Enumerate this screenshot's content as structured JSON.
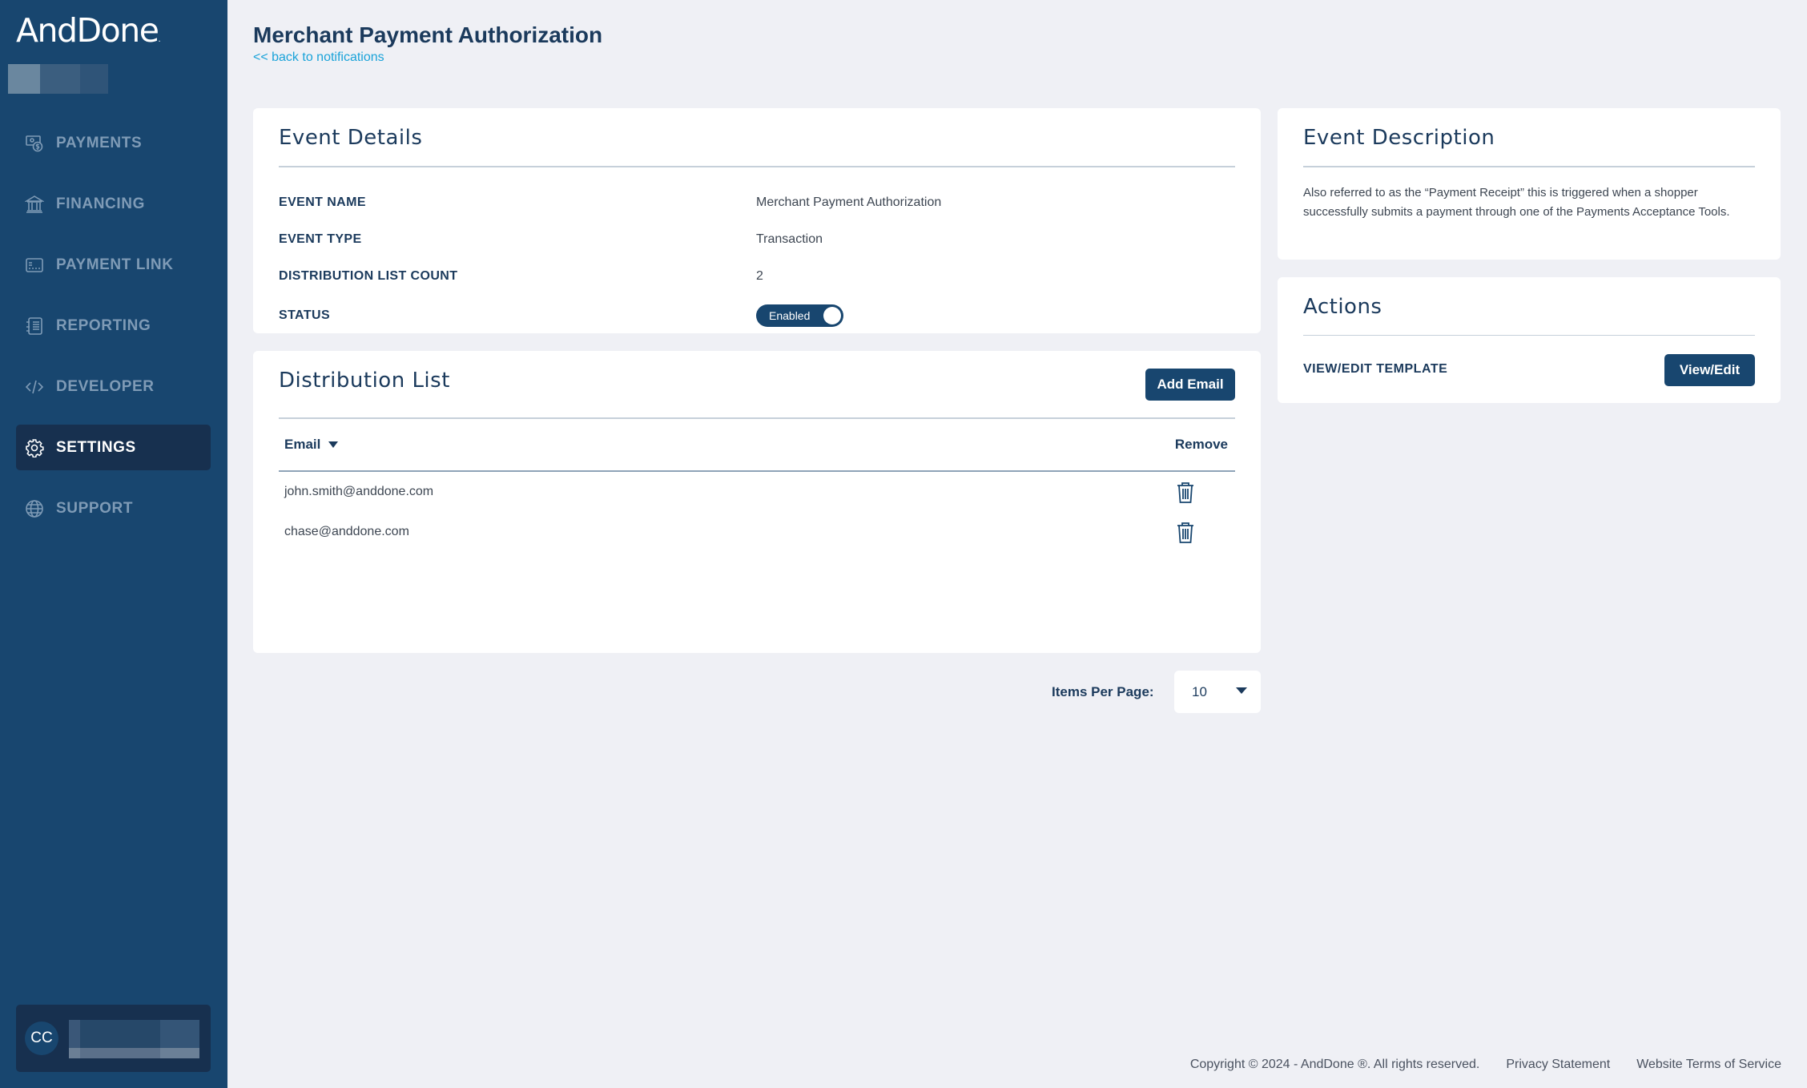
{
  "app": {
    "brand": "AndDone",
    "brand_mark": "."
  },
  "sidebar": {
    "items": [
      {
        "label": "PAYMENTS",
        "icon": "payments-icon",
        "active": false
      },
      {
        "label": "FINANCING",
        "icon": "bank-icon",
        "active": false
      },
      {
        "label": "PAYMENT LINK",
        "icon": "payment-link-icon",
        "active": false
      },
      {
        "label": "REPORTING",
        "icon": "reporting-icon",
        "active": false
      },
      {
        "label": "DEVELOPER",
        "icon": "code-icon",
        "active": false
      },
      {
        "label": "SETTINGS",
        "icon": "gear-icon",
        "active": true
      },
      {
        "label": "SUPPORT",
        "icon": "globe-icon",
        "active": false
      }
    ],
    "user": {
      "initials": "CC"
    }
  },
  "header": {
    "title": "Merchant Payment Authorization",
    "back_link": "<< back to notifications"
  },
  "event_details": {
    "title": "Event Details",
    "rows": [
      {
        "label": "EVENT NAME",
        "value": "Merchant Payment Authorization"
      },
      {
        "label": "EVENT TYPE",
        "value": "Transaction"
      },
      {
        "label": "DISTRIBUTION LIST COUNT",
        "value": "2"
      },
      {
        "label": "STATUS",
        "value": "Enabled"
      }
    ],
    "status_enabled": true
  },
  "distribution_list": {
    "title": "Distribution List",
    "add_button": "Add Email",
    "columns": {
      "email": "Email",
      "remove": "Remove"
    },
    "emails": [
      "john.smith@anddone.com",
      "chase@anddone.com"
    ]
  },
  "pagination": {
    "label": "Items Per Page:",
    "selected": "10"
  },
  "event_description": {
    "title": "Event Description",
    "text": "Also referred to as the “Payment Receipt” this is triggered when a shopper successfully submits a payment through one of the Payments Acceptance Tools."
  },
  "actions": {
    "title": "Actions",
    "template_label": "VIEW/EDIT TEMPLATE",
    "template_button": "View/Edit"
  },
  "footer": {
    "copyright": "Copyright © 2024 - AndDone ®. All rights reserved.",
    "privacy": "Privacy Statement",
    "terms": "Website Terms of Service"
  },
  "colors": {
    "sidebar": "#18466f",
    "sidebar_active": "#17304f",
    "primary": "#18466f",
    "link": "#1aa3d9",
    "background": "#eff0f5"
  }
}
